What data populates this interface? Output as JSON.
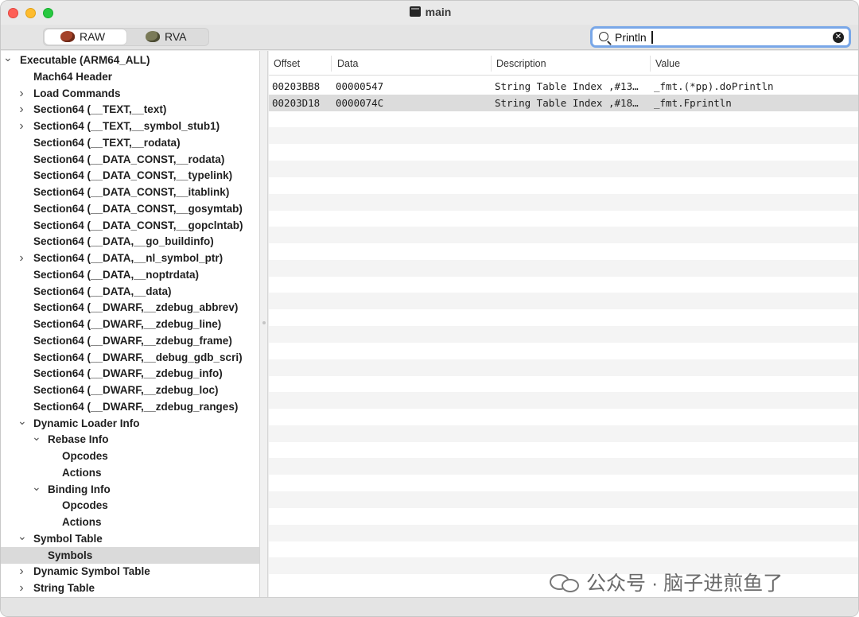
{
  "window": {
    "title": "main"
  },
  "toolbar": {
    "modes": [
      {
        "label": "RAW",
        "selected": true
      },
      {
        "label": "RVA",
        "selected": false
      }
    ],
    "search": {
      "value": "Println",
      "placeholder": ""
    }
  },
  "sidebar": {
    "items": [
      {
        "label": "Executable  (ARM64_ALL)",
        "level": 0,
        "chevron": "down"
      },
      {
        "label": "Mach64 Header",
        "level": 1,
        "chevron": ""
      },
      {
        "label": "Load Commands",
        "level": 1,
        "chevron": "right"
      },
      {
        "label": "Section64 (__TEXT,__text)",
        "level": 1,
        "chevron": "right"
      },
      {
        "label": "Section64 (__TEXT,__symbol_stub1)",
        "level": 1,
        "chevron": "right"
      },
      {
        "label": "Section64 (__TEXT,__rodata)",
        "level": 1,
        "chevron": ""
      },
      {
        "label": "Section64 (__DATA_CONST,__rodata)",
        "level": 1,
        "chevron": ""
      },
      {
        "label": "Section64 (__DATA_CONST,__typelink)",
        "level": 1,
        "chevron": ""
      },
      {
        "label": "Section64 (__DATA_CONST,__itablink)",
        "level": 1,
        "chevron": ""
      },
      {
        "label": "Section64 (__DATA_CONST,__gosymtab)",
        "level": 1,
        "chevron": ""
      },
      {
        "label": "Section64 (__DATA_CONST,__gopclntab)",
        "level": 1,
        "chevron": ""
      },
      {
        "label": "Section64 (__DATA,__go_buildinfo)",
        "level": 1,
        "chevron": ""
      },
      {
        "label": "Section64 (__DATA,__nl_symbol_ptr)",
        "level": 1,
        "chevron": "right"
      },
      {
        "label": "Section64 (__DATA,__noptrdata)",
        "level": 1,
        "chevron": ""
      },
      {
        "label": "Section64 (__DATA,__data)",
        "level": 1,
        "chevron": ""
      },
      {
        "label": "Section64 (__DWARF,__zdebug_abbrev)",
        "level": 1,
        "chevron": ""
      },
      {
        "label": "Section64 (__DWARF,__zdebug_line)",
        "level": 1,
        "chevron": ""
      },
      {
        "label": "Section64 (__DWARF,__zdebug_frame)",
        "level": 1,
        "chevron": ""
      },
      {
        "label": "Section64 (__DWARF,__debug_gdb_scri)",
        "level": 1,
        "chevron": ""
      },
      {
        "label": "Section64 (__DWARF,__zdebug_info)",
        "level": 1,
        "chevron": ""
      },
      {
        "label": "Section64 (__DWARF,__zdebug_loc)",
        "level": 1,
        "chevron": ""
      },
      {
        "label": "Section64 (__DWARF,__zdebug_ranges)",
        "level": 1,
        "chevron": ""
      },
      {
        "label": "Dynamic Loader Info",
        "level": 1,
        "chevron": "down"
      },
      {
        "label": "Rebase Info",
        "level": 2,
        "chevron": "down"
      },
      {
        "label": "Opcodes",
        "level": 3,
        "chevron": ""
      },
      {
        "label": "Actions",
        "level": 3,
        "chevron": ""
      },
      {
        "label": "Binding Info",
        "level": 2,
        "chevron": "down"
      },
      {
        "label": "Opcodes",
        "level": 3,
        "chevron": ""
      },
      {
        "label": "Actions",
        "level": 3,
        "chevron": ""
      },
      {
        "label": "Symbol Table",
        "level": 1,
        "chevron": "down"
      },
      {
        "label": "Symbols",
        "level": 2,
        "chevron": "",
        "selected": true
      },
      {
        "label": "Dynamic Symbol Table",
        "level": 1,
        "chevron": "right"
      },
      {
        "label": "String Table",
        "level": 1,
        "chevron": "right"
      }
    ]
  },
  "table": {
    "columns": [
      "Offset",
      "Data",
      "Description",
      "Value"
    ],
    "rows": [
      {
        "offset": "00203BB8",
        "data": "00000547",
        "description": "String Table Index ,#13…",
        "value": "_fmt.(*pp).doPrintln"
      },
      {
        "offset": "00203D18",
        "data": "0000074C",
        "description": "String Table Index ,#18…",
        "value": "_fmt.Fprintln",
        "selected": true
      }
    ]
  },
  "watermark": {
    "text": "公众号 · 脑子进煎鱼了"
  }
}
